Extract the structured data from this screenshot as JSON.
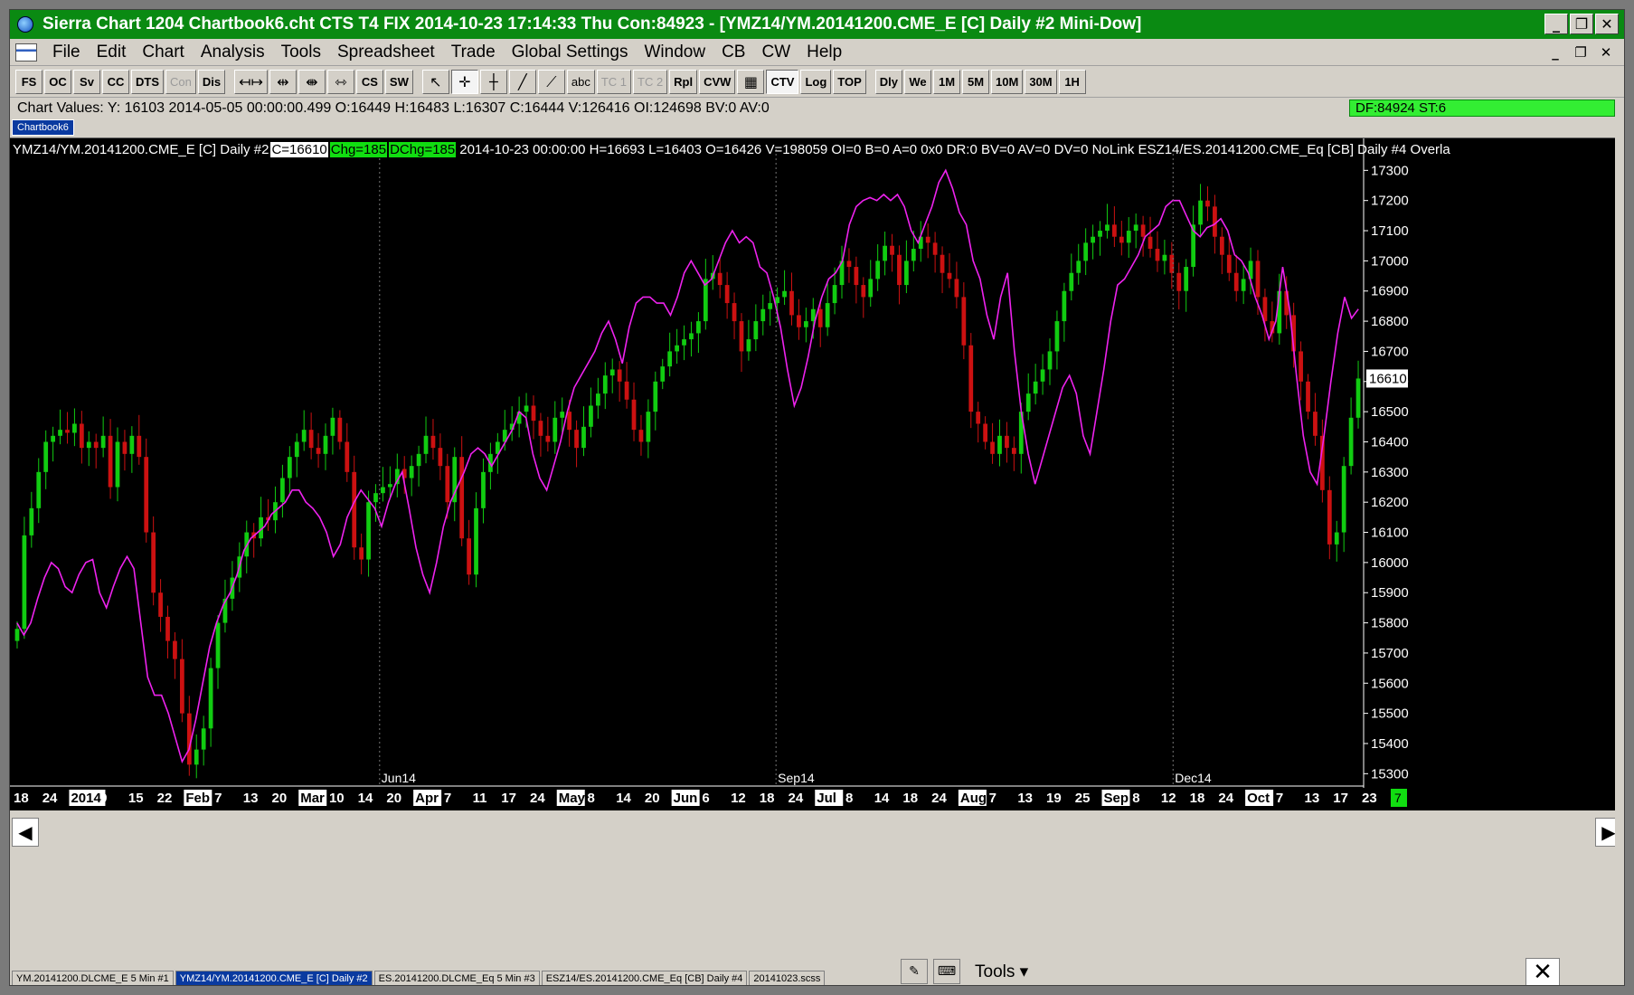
{
  "window": {
    "title": "Sierra Chart 1204 Chartbook6.cht  CTS T4 FIX 2014-10-23  17:14:33 Thu   Con:84923 - [YMZ14/YM.20141200.CME_E [C]  Daily  #2  Mini-Dow]"
  },
  "menu": [
    "File",
    "Edit",
    "Chart",
    "Analysis",
    "Tools",
    "Spreadsheet",
    "Trade",
    "Global Settings",
    "Window",
    "CB",
    "CW",
    "Help"
  ],
  "toolbar": {
    "group1": [
      "FS",
      "OC",
      "Sv",
      "CC",
      "DTS",
      "Con",
      "Dis"
    ],
    "group2": [
      "CS",
      "SW"
    ],
    "group3": [
      "abc",
      "TC 1",
      "TC 2",
      "Rpl",
      "CVW"
    ],
    "group4": [
      "CTV",
      "Log",
      "TOP",
      "Dly",
      "We",
      "1M",
      "5M",
      "10M",
      "30M",
      "1H"
    ]
  },
  "chart_values": "Chart Values: Y: 16103  2014-05-05  00:00:00.499  O:16449  H:16483  L:16307  C:16444  V:126416  OI:124698  BV:0  AV:0",
  "status": "DF:84924  ST:6",
  "chartbook_tab": "Chartbook6",
  "header": {
    "symbol": "YMZ14/YM.20141200.CME_E [C]  Daily  #2",
    "close": "C=16610",
    "chg": "Chg=185",
    "dchg": "DChg=185",
    "rest": "2014-10-23 00:00:00 H=16693 L=16403 O=16426 V=198059 OI=0 B=0 A=0 0x0 DR:0 BV=0 AV=0 DV=0 NoLink  ESZ14/ES.20141200.CME_Eq [CB]  Daily  #4 Overla"
  },
  "colors": {
    "up": "#11cc11",
    "down": "#cc1111",
    "overlay": "#ee22ee",
    "title_bg": "#0a8a12",
    "price_box": "#ffffff"
  },
  "chart_data": {
    "type": "candlestick",
    "y_ticks": [
      17300,
      17200,
      17100,
      17000,
      16900,
      16800,
      16700,
      16600,
      16500,
      16400,
      16300,
      16200,
      16100,
      16000,
      15900,
      15800,
      15700,
      15600,
      15500,
      15400,
      15300
    ],
    "ylim": [
      15265,
      17340
    ],
    "current_price": "16610",
    "x_labels": [
      "18",
      "24",
      "2014",
      "9",
      "15",
      "22",
      "Feb",
      "7",
      "13",
      "20",
      "Mar",
      "10",
      "14",
      "20",
      "Apr",
      "7",
      "11",
      "17",
      "24",
      "May",
      "8",
      "14",
      "20",
      "Jun",
      "6",
      "12",
      "18",
      "24",
      "Jul",
      "8",
      "14",
      "18",
      "24",
      "Aug",
      "7",
      "13",
      "19",
      "25",
      "Sep",
      "8",
      "12",
      "18",
      "24",
      "Oct",
      "7",
      "13",
      "17",
      "23"
    ],
    "x_highlight": [
      "2014",
      "Feb",
      "Mar",
      "Apr",
      "May",
      "Jun",
      "Jul",
      "Aug",
      "Sep",
      "Oct"
    ],
    "period_markers": [
      "Jun14",
      "Sep14",
      "Dec14"
    ],
    "right_box": "7",
    "closes": [
      15780,
      16090,
      16180,
      16300,
      16400,
      16420,
      16440,
      16430,
      16460,
      16380,
      16400,
      16380,
      16420,
      16250,
      16400,
      16360,
      16420,
      16350,
      16100,
      15900,
      15820,
      15740,
      15680,
      15500,
      15330,
      15380,
      15450,
      15650,
      15800,
      15880,
      15950,
      16020,
      16100,
      16080,
      16150,
      16140,
      16200,
      16280,
      16350,
      16400,
      16440,
      16380,
      16360,
      16420,
      16480,
      16400,
      16300,
      16050,
      16010,
      16200,
      16230,
      16250,
      16260,
      16310,
      16280,
      16320,
      16360,
      16420,
      16380,
      16320,
      16200,
      16350,
      16080,
      15960,
      16180,
      16300,
      16360,
      16400,
      16440,
      16460,
      16500,
      16520,
      16470,
      16420,
      16400,
      16480,
      16500,
      16440,
      16380,
      16450,
      16520,
      16560,
      16620,
      16640,
      16600,
      16540,
      16440,
      16400,
      16500,
      16600,
      16650,
      16700,
      16720,
      16740,
      16760,
      16800,
      16940,
      16960,
      16920,
      16860,
      16800,
      16700,
      16740,
      16800,
      16840,
      16860,
      16880,
      16900,
      16820,
      16780,
      16800,
      16840,
      16780,
      16860,
      16920,
      17000,
      16980,
      16920,
      16880,
      16940,
      17000,
      17050,
      17020,
      16920,
      17000,
      17040,
      17080,
      17060,
      17020,
      16960,
      16940,
      16880,
      16720,
      16500,
      16460,
      16400,
      16360,
      16420,
      16380,
      16360,
      16500,
      16560,
      16600,
      16640,
      16700,
      16800,
      16900,
      16960,
      17000,
      17060,
      17080,
      17100,
      17120,
      17080,
      17060,
      17100,
      17120,
      17080,
      17040,
      17000,
      17020,
      16960,
      16900,
      16980,
      17120,
      17200,
      17180,
      17080,
      17020,
      16960,
      16900,
      16940,
      17000,
      16880,
      16800,
      16760,
      16900,
      16820,
      16700,
      16600,
      16500,
      16420,
      16240,
      16060,
      16100,
      16320,
      16480,
      16610
    ],
    "overlay_values": [
      15800,
      15760,
      15800,
      15880,
      15950,
      16000,
      15980,
      15920,
      15900,
      15960,
      16000,
      16010,
      15900,
      15850,
      15920,
      15980,
      16020,
      15980,
      15800,
      15620,
      15560,
      15560,
      15500,
      15420,
      15340,
      15380,
      15480,
      15600,
      15720,
      15800,
      15860,
      15900,
      15960,
      16040,
      16080,
      16100,
      16120,
      16160,
      16180,
      16200,
      16240,
      16240,
      16200,
      16180,
      16150,
      16100,
      16020,
      16060,
      16150,
      16200,
      16240,
      16210,
      16180,
      16120,
      16200,
      16260,
      16300,
      16180,
      16050,
      15960,
      15900,
      16000,
      16120,
      16200,
      16250,
      16300,
      16360,
      16380,
      16360,
      16320,
      16360,
      16400,
      16440,
      16500,
      16480,
      16360,
      16280,
      16240,
      16320,
      16400,
      16500,
      16580,
      16620,
      16660,
      16700,
      16760,
      16800,
      16740,
      16660,
      16780,
      16860,
      16880,
      16880,
      16860,
      16860,
      16820,
      16880,
      16960,
      17000,
      16960,
      16920,
      16940,
      17000,
      17060,
      17100,
      17060,
      17080,
      17060,
      16980,
      16960,
      16880,
      16780,
      16640,
      16520,
      16580,
      16680,
      16800,
      16880,
      16940,
      16960,
      17000,
      17120,
      17180,
      17200,
      17210,
      17200,
      17220,
      17200,
      17220,
      17180,
      17100,
      17060,
      17120,
      17180,
      17260,
      17300,
      17240,
      17160,
      17120,
      17000,
      16940,
      16820,
      16740,
      16880,
      16960,
      16700,
      16500,
      16360,
      16260,
      16340,
      16420,
      16500,
      16580,
      16620,
      16560,
      16420,
      16360,
      16500,
      16640,
      16800,
      16920,
      16940,
      16980,
      17020,
      17080,
      17100,
      17120,
      17180,
      17200,
      17200,
      17150,
      17100,
      17080,
      17110,
      17120,
      17140,
      17100,
      17020,
      17000,
      16960,
      16880,
      16820,
      16740,
      16800,
      16980,
      16840,
      16620,
      16420,
      16300,
      16260,
      16420,
      16600,
      16760,
      16880,
      16810,
      16840
    ]
  },
  "chart_tabs": [
    {
      "label": "YM.20141200.DLCME_E  5 Min  #1",
      "active": false
    },
    {
      "label": "YMZ14/YM.20141200.CME_E [C]  Daily  #2",
      "active": true
    },
    {
      "label": "ES.20141200.DLCME_Eq  5 Min  #3",
      "active": false
    },
    {
      "label": "ESZ14/ES.20141200.CME_Eq [CB]  Daily  #4",
      "active": false
    },
    {
      "label": "20141023.scss",
      "active": false
    }
  ],
  "tools_label": "Tools"
}
